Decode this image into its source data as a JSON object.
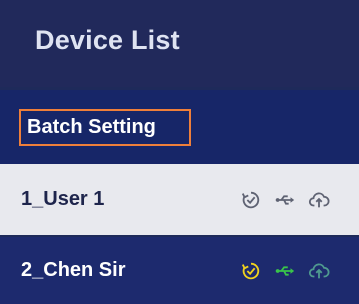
{
  "header": {
    "title": "Device List"
  },
  "batch": {
    "label": "Batch Setting"
  },
  "devices": [
    {
      "label": "1_User 1",
      "icons": [
        "sync-icon",
        "usb-icon",
        "cloud-upload-icon"
      ],
      "icon_colors": [
        "#5f6373",
        "#5f6373",
        "#5f6373"
      ]
    },
    {
      "label": "2_Chen Sir",
      "icons": [
        "sync-icon",
        "usb-icon",
        "cloud-upload-icon"
      ],
      "icon_colors": [
        "#f0d21d",
        "#39c44a",
        "#4f9a8f"
      ]
    }
  ],
  "colors": {
    "header_bg": "#21295b",
    "batch_bg": "#172668",
    "batch_border": "#ef7f3a",
    "row_light_bg": "#e8e9ee",
    "row_dark_bg": "#1d2a6e"
  }
}
